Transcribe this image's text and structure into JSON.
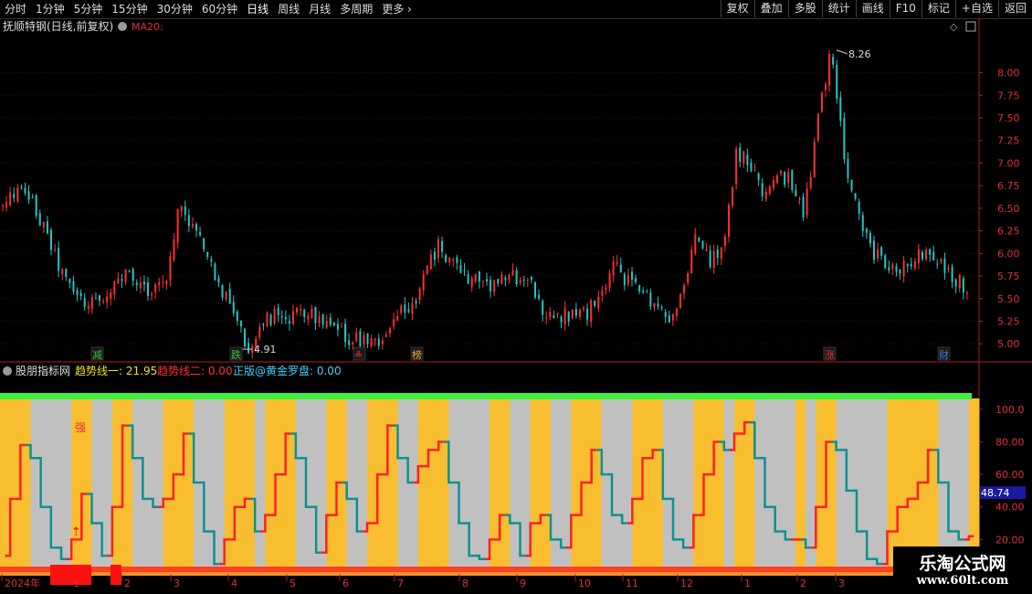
{
  "toolbar": {
    "periods": [
      "分时",
      "1分钟",
      "5分钟",
      "15分钟",
      "30分钟",
      "60分钟",
      "日线",
      "周线",
      "月线",
      "多周期",
      "更多"
    ],
    "active_index": 6,
    "right_buttons": [
      "复权",
      "叠加",
      "多股",
      "统计",
      "画线",
      "F10",
      "标记",
      "+自选",
      "返回"
    ]
  },
  "main_panel": {
    "stock_title": "抚顺特钢(日线,前复权)",
    "indicator": "MA20:",
    "high_label": "8.26",
    "low_label": "4.91",
    "y_ticks": [
      "8.00",
      "7.75",
      "7.50",
      "7.25",
      "7.00",
      "6.75",
      "6.50",
      "6.25",
      "6.00",
      "5.75",
      "5.50",
      "5.25",
      "5.00"
    ],
    "event_tags": [
      {
        "text": "减",
        "color": "#3ec23e"
      },
      {
        "text": "跌",
        "color": "#3ec23e"
      },
      {
        "text": "≗",
        "color": "#e83030"
      },
      {
        "text": "榜",
        "color": "#f0b040"
      },
      {
        "text": "涨",
        "color": "#e83030"
      },
      {
        "text": "财",
        "color": "#3a7de8"
      }
    ]
  },
  "sub_panel": {
    "name": "股朋指标网",
    "line1_label": "趋势线一: 21.95",
    "line2_label": "趋势线二: 0.00",
    "line3_label": "正版@黄金罗盘: 0.00",
    "strong_label": "强",
    "y_ticks": [
      "100.0",
      "80.00",
      "60.00",
      "40.00",
      "20.00"
    ],
    "current_value": "48.74"
  },
  "x_axis": {
    "labels": [
      "2024年",
      "1",
      "2",
      "3",
      "4",
      "5",
      "6",
      "7",
      "8",
      "9",
      "10",
      "11",
      "12",
      "1",
      "2",
      "3"
    ]
  },
  "watermark": {
    "name": "乐淘公式网",
    "url": "www.60lt.com"
  },
  "colors": {
    "up": "#ff3030",
    "down": "#20c8c8",
    "band_yellow": "#f8be30",
    "band_gray": "#c0c0c0",
    "top_bar": "#3cf03c",
    "osc_up": "#ff2020",
    "osc_down": "#109090",
    "value_box": "#1a1aa0"
  },
  "chart_data": [
    {
      "type": "candlestick",
      "title": "抚顺特钢(日线,前复权)",
      "ylim": [
        4.8,
        8.4
      ],
      "x": [
        "2024年",
        "1",
        "2",
        "3",
        "4",
        "5",
        "6",
        "7",
        "8",
        "9",
        "10",
        "11",
        "12",
        "1",
        "2",
        "3"
      ],
      "close_trend": [
        6.5,
        6.7,
        6.6,
        6.3,
        5.9,
        5.6,
        5.45,
        5.5,
        5.6,
        5.75,
        5.65,
        5.6,
        5.7,
        6.55,
        6.3,
        6.0,
        5.6,
        5.4,
        4.91,
        5.25,
        5.3,
        5.2,
        5.4,
        5.3,
        5.15,
        5.1,
        5.05,
        5.08,
        5.0,
        5.3,
        5.4,
        5.7,
        6.1,
        5.9,
        5.75,
        5.7,
        5.65,
        5.7,
        5.75,
        5.65,
        5.3,
        5.3,
        5.35,
        5.35,
        5.5,
        5.85,
        5.7,
        5.6,
        5.45,
        5.3,
        5.5,
        6.2,
        5.9,
        6.0,
        7.1,
        7.0,
        6.6,
        6.9,
        6.8,
        6.4,
        7.5,
        8.26,
        7.0,
        6.4,
        6.0,
        5.9,
        5.85,
        5.95,
        6.0,
        5.9,
        5.75,
        5.6
      ],
      "annotations": [
        {
          "text": "8.26",
          "label": "high"
        },
        {
          "text": "4.91",
          "label": "low"
        }
      ]
    },
    {
      "type": "line",
      "ylim": [
        0,
        110
      ],
      "series": [
        {
          "name": "趋势线一",
          "values": [
            10,
            45,
            78,
            70,
            40,
            15,
            8,
            20,
            48,
            30,
            10,
            40,
            90,
            70,
            45,
            40,
            45,
            60,
            85,
            55,
            25,
            5,
            20,
            40,
            45,
            25,
            35,
            60,
            85,
            70,
            40,
            12,
            35,
            55,
            45,
            25,
            30,
            60,
            90,
            70,
            55,
            65,
            75,
            80,
            55,
            30,
            10,
            8,
            20,
            35,
            30,
            10,
            30,
            35,
            20,
            15,
            35,
            55,
            75,
            60,
            35,
            30,
            45,
            70,
            75,
            45,
            20,
            15,
            35,
            60,
            80,
            75,
            85,
            92,
            70,
            40,
            25,
            20,
            20,
            15,
            40,
            80,
            75,
            50,
            25,
            8,
            5,
            25,
            40,
            45,
            55,
            75,
            55,
            25,
            20,
            22
          ]
        }
      ]
    }
  ]
}
